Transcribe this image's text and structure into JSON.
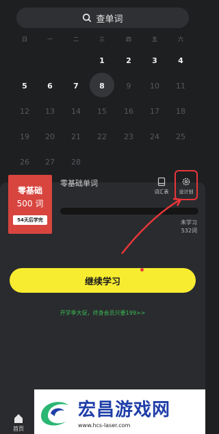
{
  "search": {
    "label": "查单词",
    "icon": "search-icon"
  },
  "calendar": {
    "weekdays": [
      "日",
      "一",
      "二",
      "三",
      "四",
      "五",
      "六"
    ],
    "rows": [
      [
        "",
        "",
        "",
        "1",
        "2",
        "3",
        "4"
      ],
      [
        "5",
        "6",
        "7",
        "8",
        "9",
        "10",
        "11"
      ],
      [
        "12",
        "13",
        "14",
        "15",
        "16",
        "17",
        "18"
      ],
      [
        "19",
        "20",
        "21",
        "22",
        "23",
        "24",
        "25"
      ],
      [
        "26",
        "27",
        "28",
        "",
        "",
        "",
        ""
      ]
    ],
    "today": "8"
  },
  "book": {
    "cover_title": "零基础",
    "cover_count": "500 词",
    "cover_plan": "54天后学完",
    "name": "零基础单词",
    "progress": 0
  },
  "actions": {
    "vocab_label": "词汇表",
    "vocab_icon": "book-icon",
    "settings_label": "设计划",
    "settings_icon": "gear-icon"
  },
  "stats": {
    "unlearned_label": "未学习",
    "unlearned_count": "532词"
  },
  "continue_button": "继续学习",
  "promo": "开学季大促，终身会员只要199>>",
  "tabbar": {
    "home_label": "首页",
    "home_icon": "home-icon"
  },
  "watermark": {
    "brand": "宏昌游戏网",
    "url": "www.hcs-laser.com"
  },
  "colors": {
    "accent_yellow": "#f8ec31",
    "cover_red": "#d8453f",
    "highlight_red": "#e8363a",
    "promo_green": "#3bbd56"
  }
}
